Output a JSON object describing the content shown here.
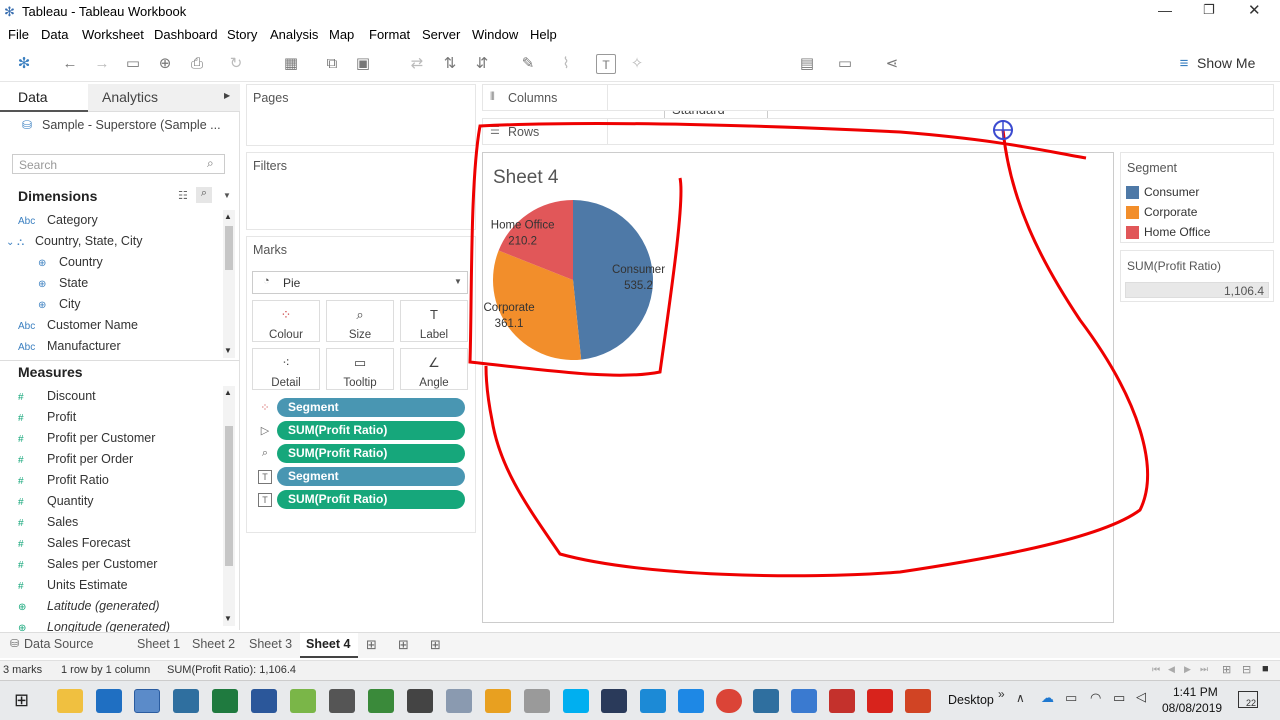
{
  "window": {
    "title": "Tableau - Tableau Workbook"
  },
  "menu": [
    "File",
    "Data",
    "Worksheet",
    "Dashboard",
    "Story",
    "Analysis",
    "Map",
    "Format",
    "Server",
    "Window",
    "Help"
  ],
  "toolbar": {
    "fit_select": "Standard",
    "show_me": "Show Me"
  },
  "left": {
    "tab_data": "Data",
    "tab_analytics": "Analytics",
    "datasource": "Sample - Superstore (Sample ...",
    "search_placeholder": "Search",
    "dimensions_header": "Dimensions",
    "dimensions": [
      {
        "type": "Abc",
        "label": "Category"
      },
      {
        "type": "hier",
        "label": "Country, State, City"
      },
      {
        "type": "globe",
        "label": "Country"
      },
      {
        "type": "globe",
        "label": "State"
      },
      {
        "type": "globe",
        "label": "City"
      },
      {
        "type": "Abc",
        "label": "Customer Name"
      },
      {
        "type": "Abc",
        "label": "Manufacturer"
      }
    ],
    "measures_header": "Measures",
    "measures": [
      {
        "type": "#",
        "label": "Discount"
      },
      {
        "type": "#",
        "label": "Profit"
      },
      {
        "type": "#",
        "label": "Profit per Customer"
      },
      {
        "type": "#",
        "label": "Profit per Order"
      },
      {
        "type": "#",
        "label": "Profit Ratio"
      },
      {
        "type": "#",
        "label": "Quantity"
      },
      {
        "type": "#",
        "label": "Sales"
      },
      {
        "type": "#",
        "label": "Sales Forecast"
      },
      {
        "type": "#",
        "label": "Sales per Customer"
      },
      {
        "type": "#",
        "label": "Units Estimate"
      },
      {
        "type": "globe",
        "label": "Latitude (generated)"
      },
      {
        "type": "globe",
        "label": "Longitude (generated)"
      }
    ]
  },
  "shelves": {
    "pages": "Pages",
    "filters": "Filters",
    "marks": "Marks",
    "mark_type": "Pie",
    "columns": "Columns",
    "rows": "Rows"
  },
  "mark_buttons": [
    "Colour",
    "Size",
    "Label",
    "Detail",
    "Tooltip",
    "Angle"
  ],
  "mark_pills": [
    {
      "icon": "colour",
      "label": "Segment",
      "color": "#4996b2"
    },
    {
      "icon": "angle",
      "label": "SUM(Profit Ratio)",
      "color": "#16a77b"
    },
    {
      "icon": "size",
      "label": "SUM(Profit Ratio)",
      "color": "#16a77b"
    },
    {
      "icon": "label",
      "label": "Segment",
      "color": "#4996b2"
    },
    {
      "icon": "label",
      "label": "SUM(Profit Ratio)",
      "color": "#16a77b"
    }
  ],
  "sheet": {
    "title": "Sheet 4"
  },
  "chart_data": {
    "type": "pie",
    "title": "Sheet 4",
    "categories": [
      "Consumer",
      "Corporate",
      "Home Office"
    ],
    "values": [
      535.2,
      361.1,
      210.2
    ],
    "labels": [
      "535.2",
      "361.1",
      "210.2"
    ],
    "colors": [
      "#4e79a7",
      "#f28e2b",
      "#e15759"
    ]
  },
  "legend": {
    "title": "Segment",
    "items": [
      {
        "label": "Consumer",
        "color": "#4e79a7"
      },
      {
        "label": "Corporate",
        "color": "#f28e2b"
      },
      {
        "label": "Home Office",
        "color": "#e15759"
      }
    ],
    "size_title": "SUM(Profit Ratio)",
    "size_value": "1,106.4"
  },
  "sheet_tabs": [
    "Data Source",
    "Sheet 1",
    "Sheet 2",
    "Sheet 3",
    "Sheet 4"
  ],
  "status": {
    "marks": "3 marks",
    "rows": "1 row by 1 column",
    "sum": "SUM(Profit Ratio): 1,106.4"
  },
  "taskbar": {
    "desktop": "Desktop",
    "time": "1:41 PM",
    "date": "08/08/2019",
    "notif": "22"
  }
}
